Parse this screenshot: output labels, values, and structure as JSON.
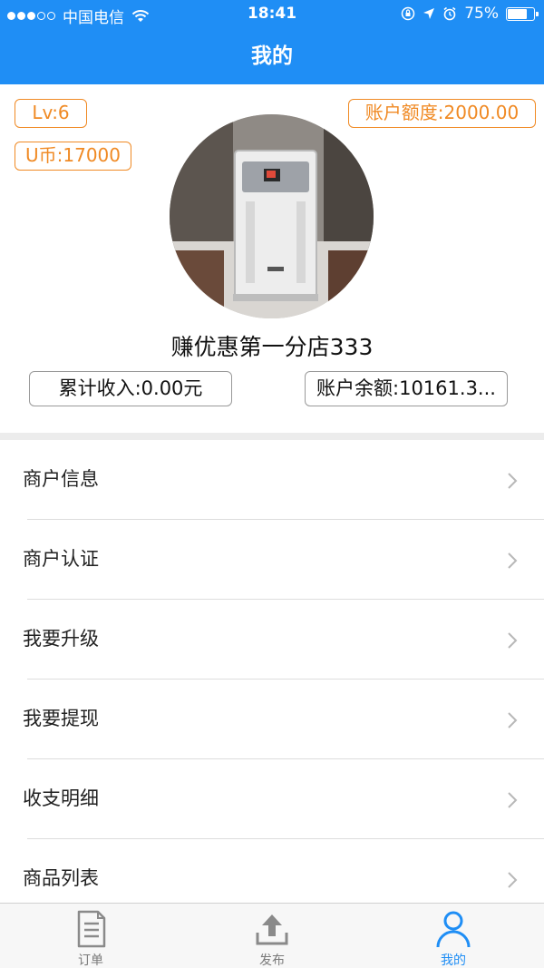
{
  "status_bar": {
    "carrier": "中国电信",
    "time": "18:41",
    "battery": "75%",
    "battery_level": 0.75
  },
  "nav": {
    "title": "我的"
  },
  "profile": {
    "level": "Lv:6",
    "coins": "U币:17000",
    "quota": "账户额度:2000.00",
    "store_name": "赚优惠第一分店333",
    "income": "累计收入:0.00元",
    "balance": "账户余额:10161.3..."
  },
  "menu": {
    "items": [
      {
        "label": "商户信息"
      },
      {
        "label": "商户认证"
      },
      {
        "label": "我要升级"
      },
      {
        "label": "我要提现"
      },
      {
        "label": "收支明细"
      },
      {
        "label": "商品列表"
      }
    ]
  },
  "tabbar": {
    "tabs": [
      {
        "label": "订单",
        "icon": "document-icon"
      },
      {
        "label": "发布",
        "icon": "upload-icon"
      },
      {
        "label": "我的",
        "icon": "person-icon",
        "active": true
      }
    ]
  },
  "colors": {
    "accent": "#1f8ef5",
    "chip": "#f08a24"
  }
}
